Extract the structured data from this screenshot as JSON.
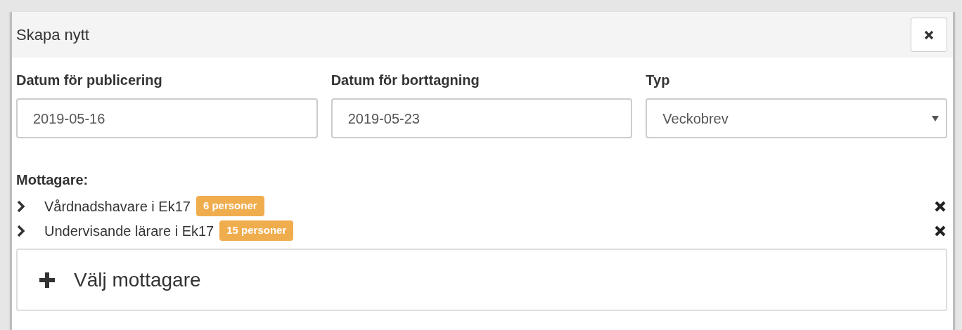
{
  "dialog": {
    "title": "Skapa nytt"
  },
  "fields": [
    {
      "kind": "date",
      "label": "Datum för publicering",
      "value": "2019-05-16"
    },
    {
      "kind": "date",
      "label": "Datum för borttagning",
      "value": "2019-05-23"
    },
    {
      "kind": "select",
      "label": "Typ",
      "value": "Veckobrev"
    }
  ],
  "recipients": {
    "label": "Mottagare:",
    "items": [
      {
        "name": "Vårdnadshavare i Ek17",
        "badge": "6 personer",
        "expanded": false
      },
      {
        "name": "Undervisande lärare i Ek17",
        "badge": "15 personer",
        "expanded": false
      }
    ]
  },
  "add_button": {
    "label": "Välj mottagare"
  }
}
